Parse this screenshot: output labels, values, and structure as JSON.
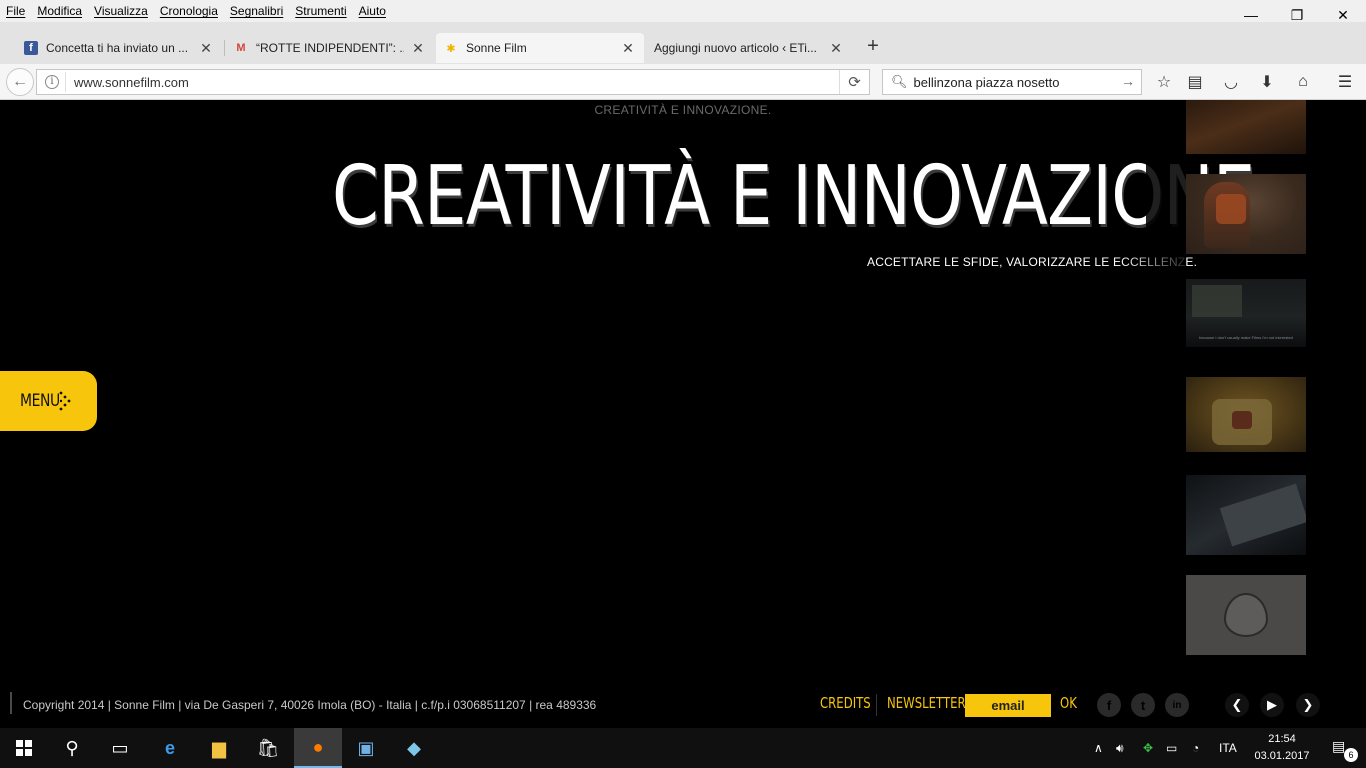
{
  "menubar": {
    "items": [
      "File",
      "Modifica",
      "Visualizza",
      "Cronologia",
      "Segnalibri",
      "Strumenti",
      "Aiuto"
    ]
  },
  "window_controls": {
    "minimize": "—",
    "restore": "❐",
    "close": "✕"
  },
  "tabs": [
    {
      "title": "Concetta ti ha inviato un ...",
      "icon": "facebook-icon",
      "close": "✕"
    },
    {
      "title": "“ROTTE INDIPENDENTI”: ...",
      "icon": "gmail-icon",
      "close": "✕"
    },
    {
      "title": "Sonne Film",
      "icon": "sonne-film-icon",
      "close": "✕"
    },
    {
      "title": "Aggiungi nuovo articolo ‹ ETi...",
      "icon": "",
      "close": "✕"
    }
  ],
  "newtab": "+",
  "nav": {
    "url": "www.sonnefilm.com",
    "search_value": "bellinzona piazza nosetto"
  },
  "page": {
    "small_tagline": "CREATIVITÀ E INNOVAZIONE.",
    "headline": "CREATIVITÀ E INNOVAZIONE.",
    "subline": "ACCETTARE LE SFIDE, VALORIZZARE LE ECCELLENZE.",
    "menu_label": "MENU",
    "thumb3_caption": "because I don't usually make Films I'm not interested",
    "thumbnails": [
      "thumb-1",
      "thumb-2",
      "thumb-3",
      "thumb-4",
      "thumb-5",
      "thumb-6"
    ]
  },
  "footer": {
    "copyright": "Copyright 2014 | Sonne Film | via De Gasperi 7, 40026 Imola (BO) - Italia | c.f/p.i 03068511207 | rea 489336",
    "credits": "CREDITS",
    "newsletter": "NEWSLETTER",
    "email_placeholder": "email",
    "ok": "OK",
    "social": [
      "f",
      "t",
      "in"
    ]
  },
  "taskbar": {
    "language": "ITA",
    "time": "21:54",
    "date": "03.01.2017",
    "notifications": "6"
  },
  "colors": {
    "accent": "#f7c60c",
    "page_bg": "#000000"
  }
}
